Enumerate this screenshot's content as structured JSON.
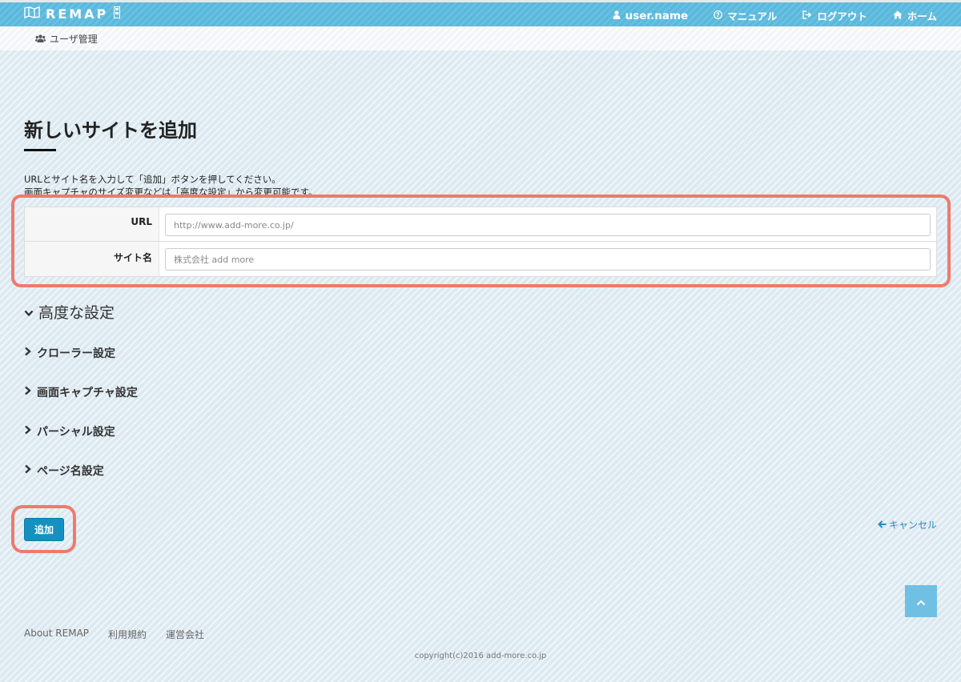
{
  "header": {
    "logo_text": "REMAP",
    "nav": {
      "user": "user.name",
      "manual": "マニュアル",
      "logout": "ログアウト",
      "home": "ホーム"
    }
  },
  "subnav": {
    "user_admin": "ユーザ管理"
  },
  "main": {
    "title": "新しいサイトを追加",
    "description": [
      "URLとサイト名を入力して「追加」ボタンを押してください。",
      "画面キャプチャのサイズ変更などは「高度な設定」から変更可能です。"
    ],
    "form": {
      "url_label": "URL",
      "url_placeholder": "http://www.add-more.co.jp/",
      "site_label": "サイト名",
      "site_placeholder": "株式会社 add more"
    },
    "advanced": {
      "heading": "高度な設定",
      "sections": [
        "クローラー設定",
        "画面キャプチャ設定",
        "パーシャル設定",
        "ページ名設定"
      ]
    },
    "add_button": "追加",
    "cancel": "キャンセル"
  },
  "footer": {
    "links": [
      "About REMAP",
      "利用規約",
      "運営会社"
    ],
    "copyright": "copyright(c)2016 add-more.co.jp"
  },
  "colors": {
    "header_bg": "#5ab9dc",
    "primary_button": "#1591c1",
    "highlight": "#ef7a6c",
    "link": "#2a8ac0"
  }
}
